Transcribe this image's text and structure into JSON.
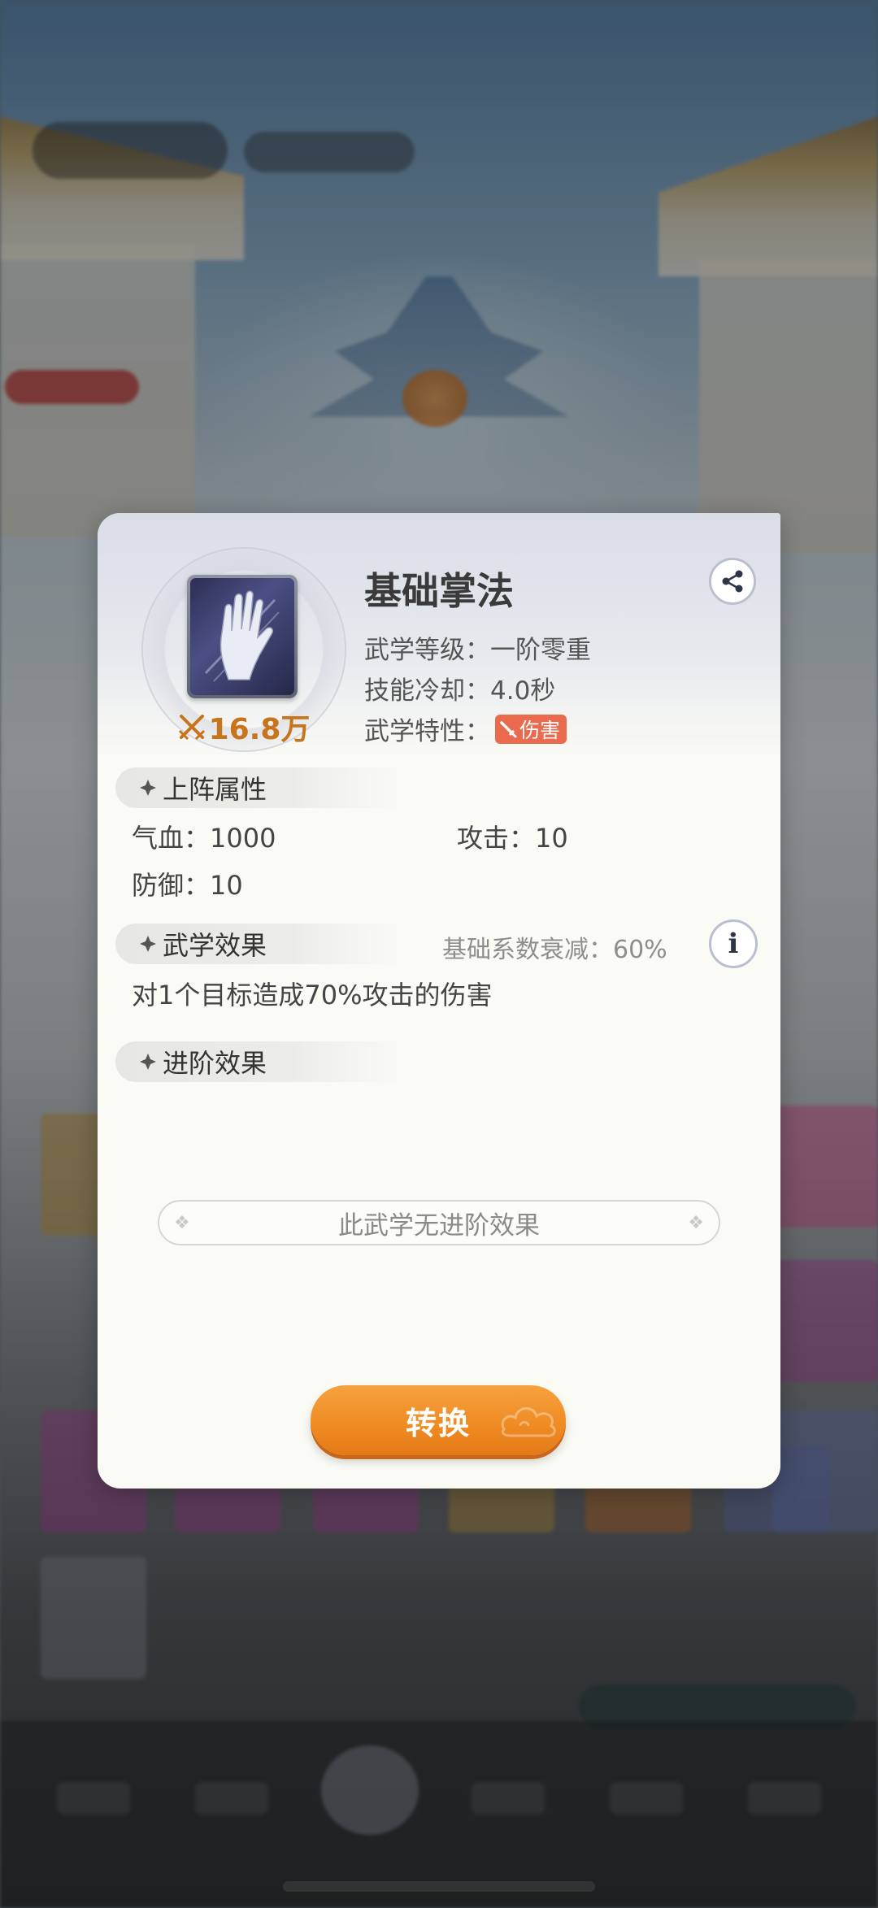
{
  "skill": {
    "name": "基础掌法",
    "power": "16.8万",
    "level_line": "武学等级：一阶零重",
    "cooldown_line": "技能冷却：4.0秒",
    "trait_label": "武学特性：",
    "trait_badge": "伤害"
  },
  "sections": {
    "deploy_title": "上阵属性",
    "effect_title": "武学效果",
    "advance_title": "进阶效果"
  },
  "attributes": {
    "hp": "气血：1000",
    "attack": "攻击：10",
    "defense": "防御：10"
  },
  "effect": {
    "decay": "基础系数衰减：60%",
    "description": "对1个目标造成70%攻击的伤害"
  },
  "advance": {
    "empty_text": "此武学无进阶效果"
  },
  "buttons": {
    "convert": "转换"
  },
  "icons": {
    "share": "share-icon",
    "info": "info-icon",
    "power": "crossed-swords-icon",
    "section": "diamond-icon",
    "trait": "sword-icon"
  },
  "colors": {
    "accent_orange": "#ef8a22",
    "power_text": "#c7741c",
    "trait_badge": "#ea6a4d"
  }
}
